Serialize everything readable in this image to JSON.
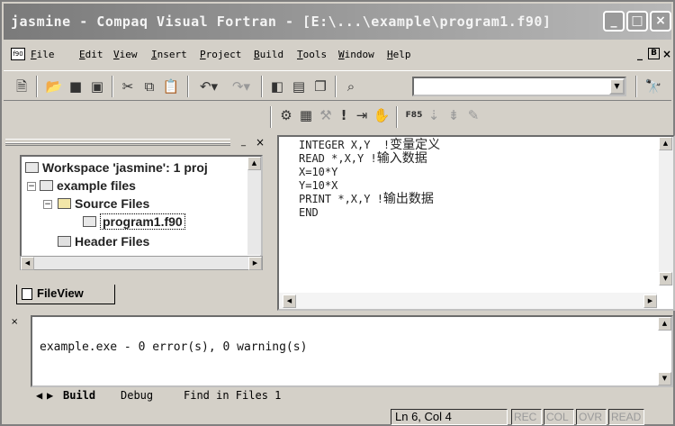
{
  "window": {
    "title": "jasmine - Compaq Visual Fortran - [E:\\...\\example\\program1.f90]",
    "controls": [
      "_",
      "□",
      "×"
    ]
  },
  "menu": {
    "items": [
      {
        "hotkey": "F",
        "rest": "ile"
      },
      {
        "hotkey": "E",
        "rest": "dit"
      },
      {
        "hotkey": "V",
        "rest": "iew"
      },
      {
        "hotkey": "I",
        "rest": "nsert"
      },
      {
        "hotkey": "P",
        "rest": "roject"
      },
      {
        "hotkey": "B",
        "rest": "uild"
      },
      {
        "hotkey": "T",
        "rest": "ools"
      },
      {
        "hotkey": "W",
        "rest": "indow"
      },
      {
        "hotkey": "H",
        "rest": "elp"
      }
    ],
    "mdi_controls": [
      "_",
      "B",
      "×"
    ]
  },
  "toolbar": {
    "find_combo_value": "",
    "icons": [
      "new-text-file-icon",
      "open-folder-icon",
      "save-icon",
      "save-all-icon",
      "cut-icon",
      "copy-icon",
      "paste-icon",
      "undo-icon",
      "redo-icon",
      "workspace-icon",
      "output-icon",
      "window-list-icon",
      "find-in-files-icon",
      "find-icon"
    ]
  },
  "build_toolbar": {
    "icons": [
      "compile-icon",
      "build-icon",
      "stop-build-icon",
      "execute-icon",
      "go-icon",
      "breakpoint-icon",
      "fortran-icon",
      "step-icon",
      "run-to-icon",
      "edit-icon"
    ]
  },
  "workspace": {
    "pane_controls": [
      "_",
      "×"
    ],
    "tree": {
      "workspace_label": "Workspace 'jasmine': 1 proj",
      "project_label": "example files",
      "source_folder": "Source Files",
      "source_file": "program1.f90",
      "header_folder": "Header Files"
    },
    "tab_label": "FileView"
  },
  "editor": {
    "lines": [
      {
        "code": "INTEGER X,Y  !",
        "comment": "变量定义"
      },
      {
        "code": "READ *,X,Y !",
        "comment": "输入数据"
      },
      {
        "code": "X=10*Y",
        "comment": ""
      },
      {
        "code": "Y=10*X",
        "comment": ""
      },
      {
        "code": "PRINT *,X,Y !",
        "comment": "输出数据"
      },
      {
        "code": "END",
        "comment": ""
      }
    ]
  },
  "output": {
    "message": "example.exe - 0 error(s), 0 warning(s)",
    "tabs": [
      "Build",
      "Debug",
      "Find in Files 1"
    ],
    "active_tab": "Build"
  },
  "status": {
    "position": "Ln 6, Col 4",
    "indicators": [
      "REC",
      "COL",
      "OVR",
      "READ"
    ]
  }
}
